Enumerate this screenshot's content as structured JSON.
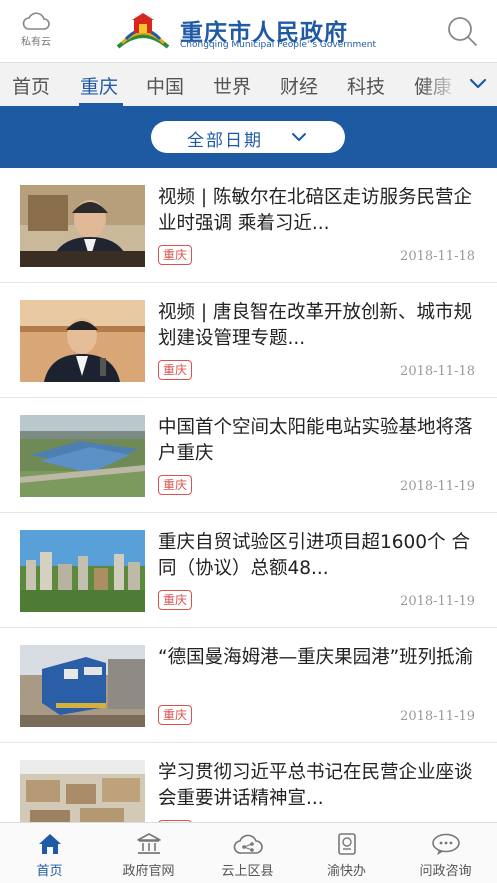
{
  "header": {
    "cloud_label": "私有云",
    "logo_title": "重庆市人民政府",
    "logo_subtitle": "Chongqing Municipal People' s Government",
    "search_icon": "search-icon",
    "brand_color": "#1f5aa6"
  },
  "tabs": [
    {
      "label": "首页",
      "active": false
    },
    {
      "label": "重庆",
      "active": true
    },
    {
      "label": "中国",
      "active": false
    },
    {
      "label": "世界",
      "active": false
    },
    {
      "label": "财经",
      "active": false
    },
    {
      "label": "科技",
      "active": false
    },
    {
      "label": "健康",
      "active": false
    }
  ],
  "date_filter": {
    "label": "全部日期",
    "icon": "chevron-down-icon",
    "bar_color": "#1e5aa2"
  },
  "news": [
    {
      "title": "视频 | 陈敏尔在北碚区走访服务民营企业时强调 乘着习近...",
      "tag": "重庆",
      "date": "2018-11-18",
      "thumb": "meeting-speaker"
    },
    {
      "title": "视频 | 唐良智在改革开放创新、城市规划建设管理专题...",
      "tag": "重庆",
      "date": "2018-11-18",
      "thumb": "meeting-speaker"
    },
    {
      "title": "中国首个空间太阳能电站实验基地将落户重庆",
      "tag": "重庆",
      "date": "2018-11-19",
      "thumb": "aerial-industrial"
    },
    {
      "title": "重庆自贸试验区引进项目超1600个 合同（协议）总额48...",
      "tag": "重庆",
      "date": "2018-11-19",
      "thumb": "city-skyline"
    },
    {
      "title": "“德国曼海姆港—重庆果园港”班列抵渝",
      "tag": "重庆",
      "date": "2018-11-19",
      "thumb": "freight-train"
    },
    {
      "title": "学习贯彻习近平总书记在民营企业座谈会重要讲话精神宣...",
      "tag": "重庆",
      "date": "",
      "thumb": "factory-floor"
    }
  ],
  "tag_color": "#d9534f",
  "bottom_nav": [
    {
      "label": "首页",
      "icon": "home-icon",
      "active": true
    },
    {
      "label": "政府官网",
      "icon": "government-building-icon",
      "active": false
    },
    {
      "label": "云上区县",
      "icon": "cloud-share-icon",
      "active": false
    },
    {
      "label": "渝快办",
      "icon": "document-service-icon",
      "active": false
    },
    {
      "label": "问政咨询",
      "icon": "chat-bubble-icon",
      "active": false
    }
  ]
}
